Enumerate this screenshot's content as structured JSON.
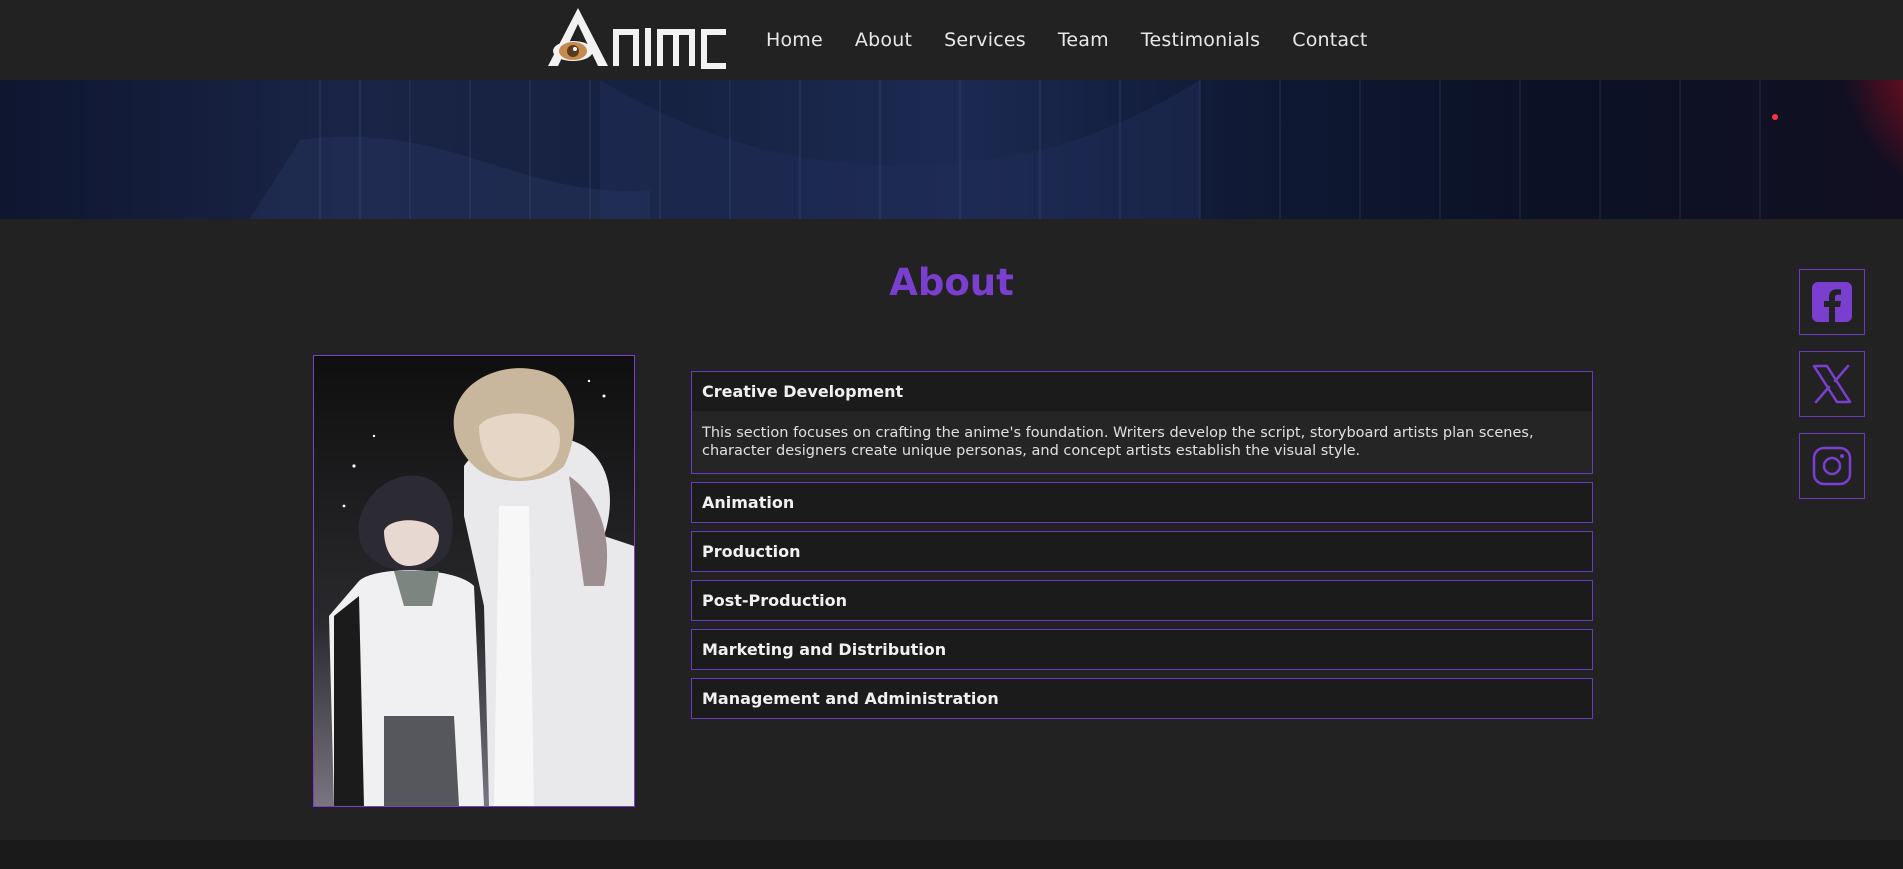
{
  "header": {
    "logo_alt": "ANIME",
    "nav": [
      "Home",
      "About",
      "Services",
      "Team",
      "Testimonials",
      "Contact"
    ]
  },
  "about": {
    "title": "About",
    "image_icon": "anime-characters-illustration",
    "accordion": [
      {
        "title": "Creative Development",
        "expanded": true,
        "body": "This section focuses on crafting the anime's foundation. Writers develop the script, storyboard artists plan scenes, character designers create unique personas, and concept artists establish the visual style."
      },
      {
        "title": "Animation",
        "expanded": false
      },
      {
        "title": "Production",
        "expanded": false
      },
      {
        "title": "Post-Production",
        "expanded": false
      },
      {
        "title": "Marketing and Distribution",
        "expanded": false
      },
      {
        "title": "Management and Administration",
        "expanded": false
      }
    ]
  },
  "social": [
    {
      "name": "facebook",
      "icon": "facebook-icon"
    },
    {
      "name": "x",
      "icon": "x-twitter-icon"
    },
    {
      "name": "instagram",
      "icon": "instagram-icon"
    }
  ],
  "colors": {
    "accent": "#7b3fd0",
    "background": "#222222",
    "panel": "#1b1b1b"
  }
}
